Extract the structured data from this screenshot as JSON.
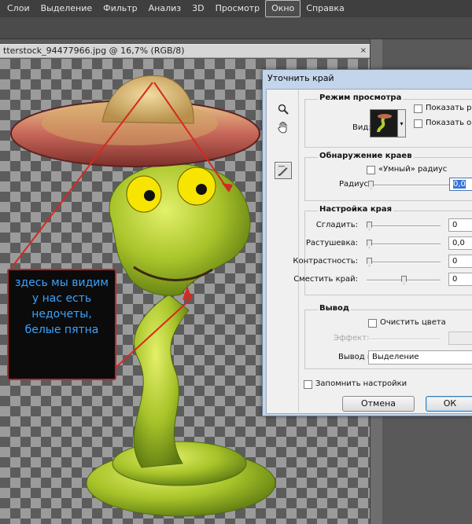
{
  "menubar": {
    "items": [
      "Слои",
      "Выделение",
      "Фильтр",
      "Анализ",
      "3D",
      "Просмотр",
      "Окно",
      "Справка"
    ],
    "active_index": 6
  },
  "document": {
    "tab_title": "tterstock_94477966.jpg @ 16,7% (RGB/8)",
    "close_glyph": "×"
  },
  "callout": {
    "text": "здесь мы видим\nу нас есть\nнедочеты,\nбелые пятна"
  },
  "dialog": {
    "title": "Уточнить край",
    "tools": [
      "zoom-icon",
      "hand-icon",
      "refine-radius-brush-icon"
    ],
    "view_mode": {
      "title": "Режим просмотра",
      "view_label": "Вид:",
      "show_radius_label": "Показать радиу",
      "show_original_label": "Показать ориги"
    },
    "edge_detection": {
      "title": "Обнаружение краев",
      "smart_radius_label": "«Умный» радиус",
      "radius_label": "Радиус:",
      "radius_value": "0,0",
      "radius_level": 0
    },
    "adjust_edge": {
      "title": "Настройка края",
      "fields": [
        {
          "label": "Сгладить:",
          "value": "0",
          "level": 0
        },
        {
          "label": "Растушевка:",
          "value": "0,0",
          "level": 0
        },
        {
          "label": "Контрастность:",
          "value": "0",
          "level": 0
        },
        {
          "label": "Сместить край:",
          "value": "0",
          "level": 0.5
        }
      ]
    },
    "output": {
      "title": "Вывод",
      "decontaminate_label": "Очистить цвета",
      "amount_label": "Эффект:",
      "output_to_label": "Вывод в:",
      "output_to_value": "Выделение"
    },
    "remember_label": "Запомнить настройки",
    "cancel_label": "Отмена",
    "ok_label": "ОК"
  },
  "colors": {
    "menubar_bg": "#3f3f3f",
    "dialog_frame": "#c3d5ea",
    "callout_text": "#3aa3ff",
    "callout_border": "#b32a2a",
    "annotation_line": "#d42a1f"
  }
}
